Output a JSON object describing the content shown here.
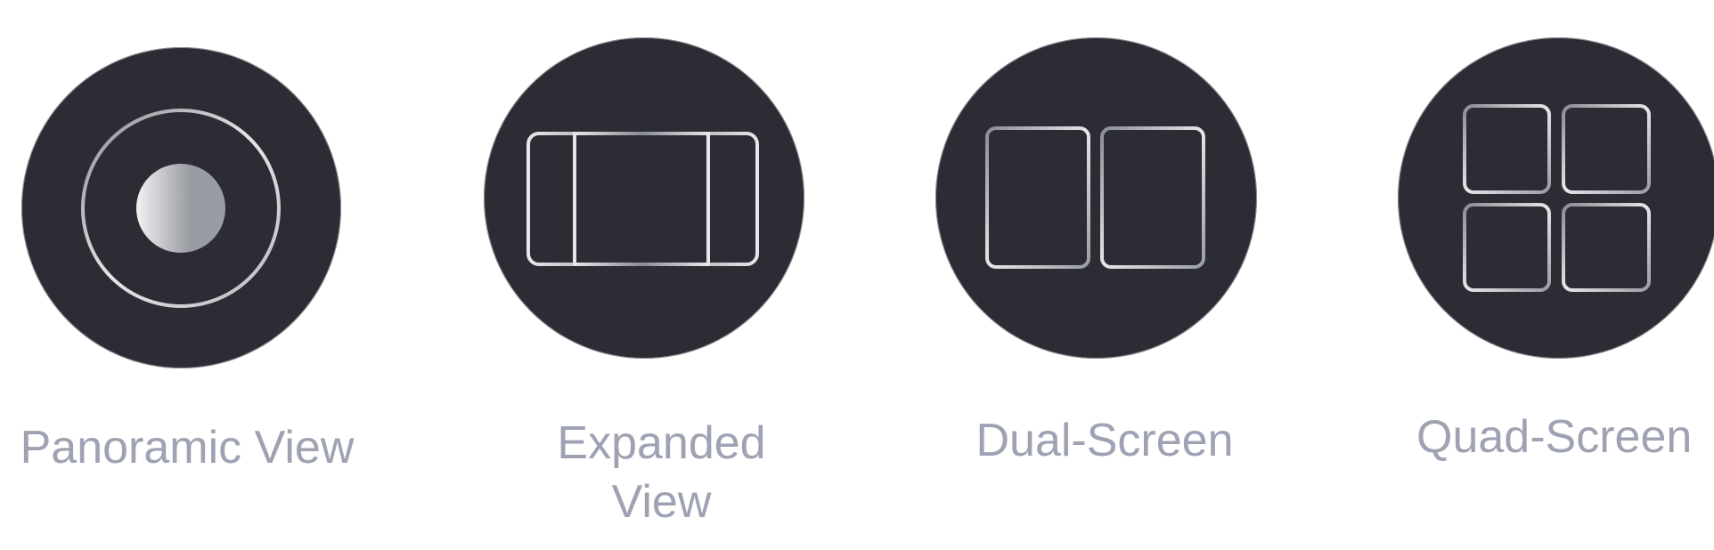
{
  "colors": {
    "button_fill": "#2c2d34",
    "label_text": "#9ea2b2",
    "icon_stroke_light": "#e6e7ea",
    "icon_stroke_dark": "#8a8c93"
  },
  "view_modes": [
    {
      "label": "Panoramic View",
      "icon": "panoramic-icon"
    },
    {
      "label": "Expanded View",
      "icon": "expanded-icon"
    },
    {
      "label": "Dual-Screen",
      "icon": "dual-screen-icon"
    },
    {
      "label": "Quad-Screen",
      "icon": "quad-screen-icon"
    }
  ]
}
